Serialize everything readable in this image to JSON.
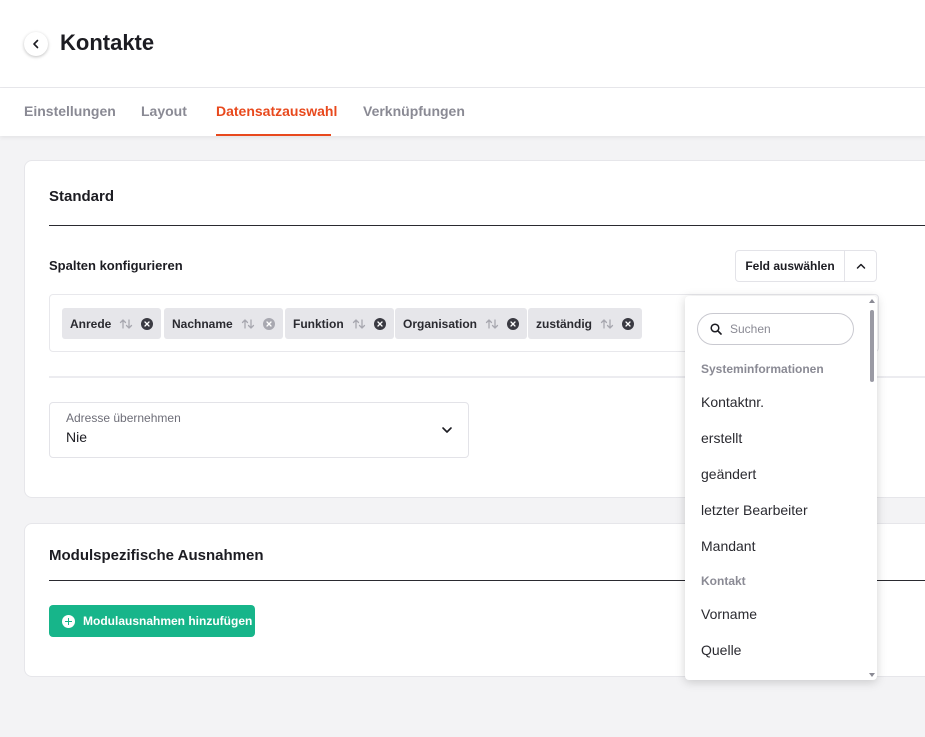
{
  "header": {
    "title": "Kontakte"
  },
  "tabs": [
    {
      "label": "Einstellungen"
    },
    {
      "label": "Layout"
    },
    {
      "label": "Datensatzauswahl"
    },
    {
      "label": "Verknüpfungen"
    }
  ],
  "active_tab": "Datensatzauswahl",
  "colors": {
    "accent": "#e8491d",
    "primary_button": "#17b58a"
  },
  "standard": {
    "title": "Standard",
    "columns_label": "Spalten konfigurieren",
    "field_select_label": "Feld auswählen",
    "chips": [
      {
        "label": "Anrede"
      },
      {
        "label": "Nachname"
      },
      {
        "label": "Funktion"
      },
      {
        "label": "Organisation"
      },
      {
        "label": "zuständig"
      }
    ],
    "address": {
      "label": "Adresse übernehmen",
      "value": "Nie"
    }
  },
  "module": {
    "title": "Modulspezifische Ausnahmen",
    "add_button": "Modulausnahmen hinzufügen"
  },
  "dropdown": {
    "search_placeholder": "Suchen",
    "groups": [
      {
        "header": "Systeminformationen",
        "items": [
          "Kontaktnr.",
          "erstellt",
          "geändert",
          "letzter Bearbeiter",
          "Mandant"
        ]
      },
      {
        "header": "Kontakt",
        "items": [
          "Vorname",
          "Quelle"
        ]
      }
    ]
  }
}
